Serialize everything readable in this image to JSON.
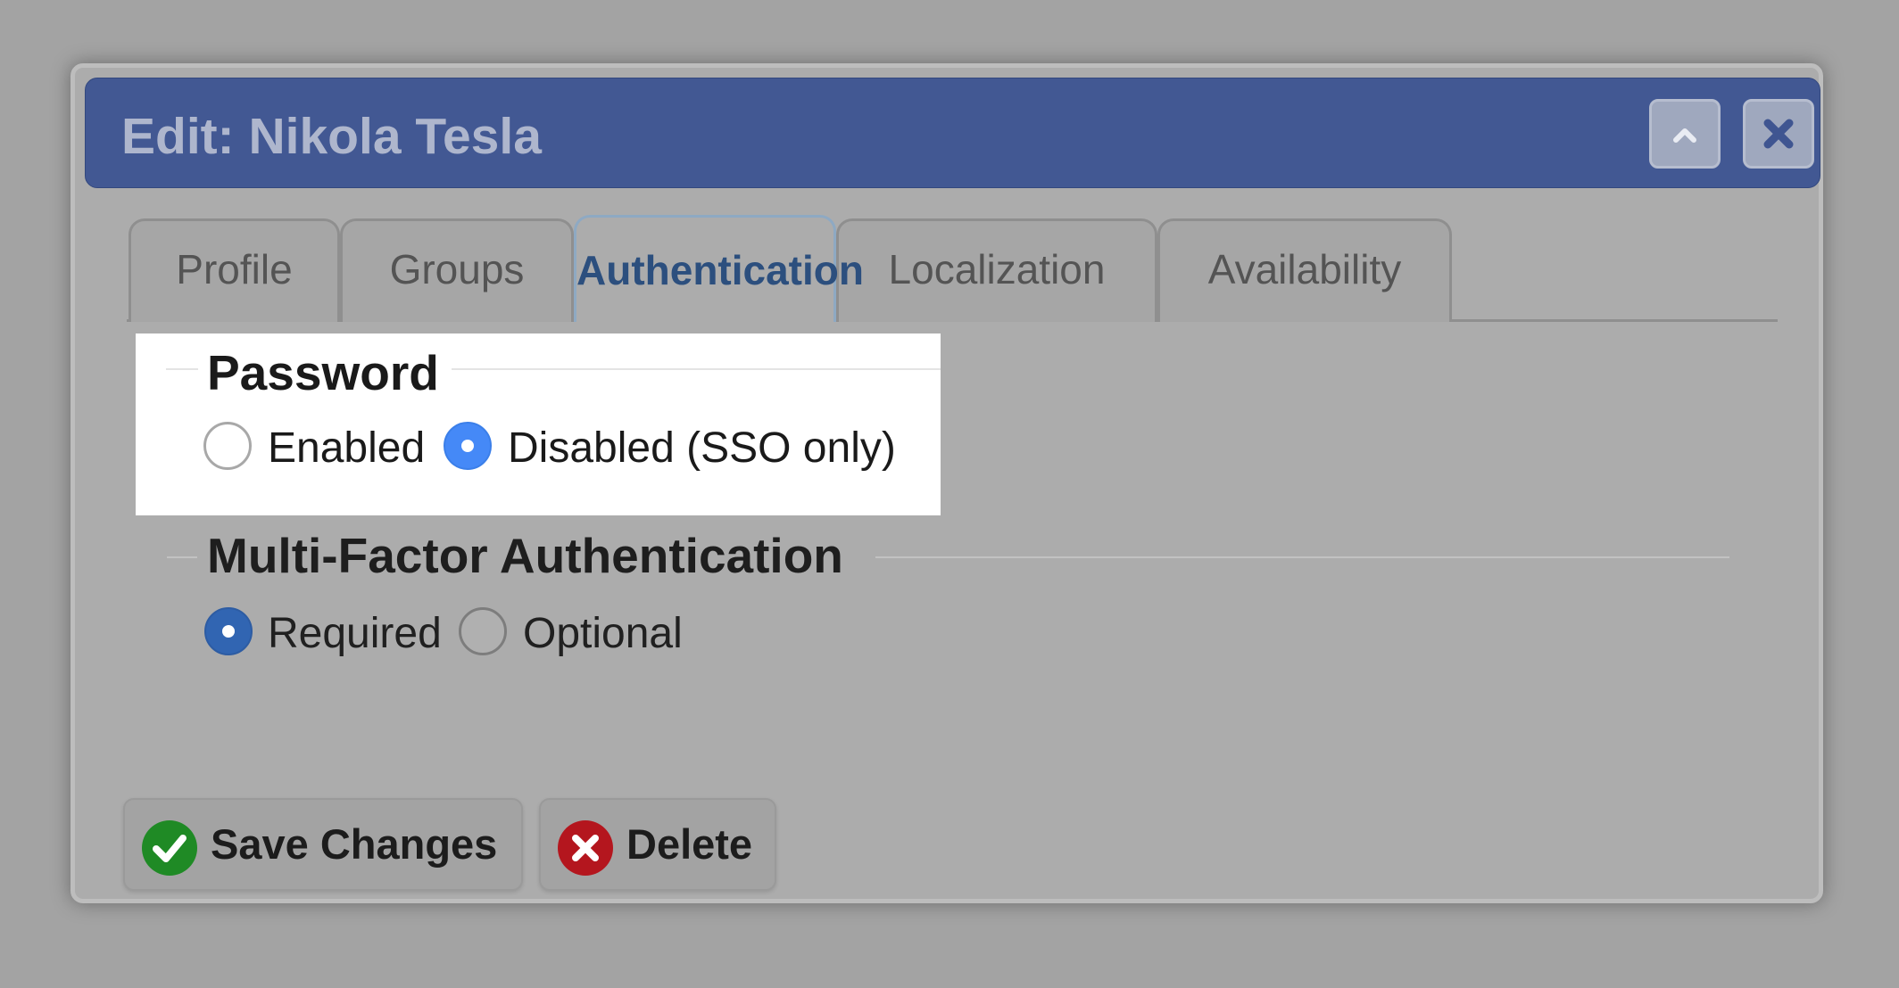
{
  "dialog": {
    "title": "Edit: Nikola Tesla",
    "collapse_icon": "chevron-up-icon",
    "close_icon": "close-x-icon"
  },
  "tabs": [
    {
      "label": "Profile",
      "active": false
    },
    {
      "label": "Groups",
      "active": false
    },
    {
      "label": "Authentication",
      "active": true
    },
    {
      "label": "Localization",
      "active": false
    },
    {
      "label": "Availability",
      "active": false
    }
  ],
  "password": {
    "legend": "Password",
    "options": [
      {
        "label": "Enabled",
        "selected": false
      },
      {
        "label": "Disabled (SSO only)",
        "selected": true
      }
    ]
  },
  "mfa": {
    "legend": "Multi-Factor Authentication",
    "options": [
      {
        "label": "Required",
        "selected": true
      },
      {
        "label": "Optional",
        "selected": false
      }
    ]
  },
  "actions": {
    "save_label": "Save Changes",
    "save_icon": "green-checkmark-icon",
    "delete_label": "Delete",
    "delete_icon": "red-x-circle-icon"
  },
  "colors": {
    "titlebar": "#425893",
    "active_tab_text": "#2c4f7e",
    "radio_selected": "#4589f7",
    "save_icon": "#1f8a25",
    "delete_icon": "#b4161e"
  }
}
